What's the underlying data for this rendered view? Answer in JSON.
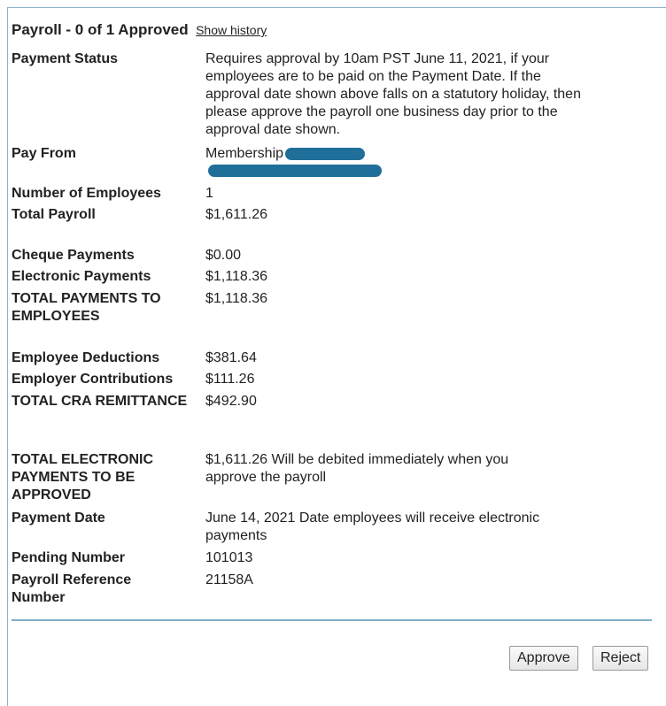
{
  "header": {
    "title": "Payroll - 0 of 1 Approved",
    "history_link": "Show history"
  },
  "rows": [
    {
      "label": "Payment Status",
      "value": "Requires approval by 10am PST June 11, 2021, if your employees are to be paid on the Payment Date. If the approval date shown above falls on a statutory holiday, then please approve the payroll one business day prior to the approval date shown."
    },
    {
      "label": "Pay From",
      "value": "Membership"
    },
    {
      "label": "Number of Employees",
      "value": "1"
    },
    {
      "label": "Total Payroll",
      "value": "$1,611.26"
    },
    {
      "label": "Cheque Payments",
      "value": "$0.00"
    },
    {
      "label": "Electronic Payments",
      "value": "$1,118.36"
    },
    {
      "label": "TOTAL PAYMENTS TO EMPLOYEES",
      "value": "$1,118.36"
    },
    {
      "label": "Employee Deductions",
      "value": "$381.64"
    },
    {
      "label": "Employer Contributions",
      "value": "$111.26"
    },
    {
      "label": "TOTAL CRA REMITTANCE",
      "value": "$492.90"
    },
    {
      "label": "TOTAL ELECTRONIC PAYMENTS TO BE APPROVED",
      "value": "$1,611.26 Will be debited immediately when you approve the payroll"
    },
    {
      "label": "Payment Date",
      "value": "June 14, 2021 Date employees will receive electronic payments"
    },
    {
      "label": "Pending Number",
      "value": "101013"
    },
    {
      "label": "Payroll Reference Number",
      "value": "21158A"
    }
  ],
  "actions": {
    "approve_label": "Approve",
    "reject_label": "Reject"
  },
  "colors": {
    "border": "#8fb3c9",
    "divider": "#7faec6",
    "redaction": "#1f6f9a"
  }
}
